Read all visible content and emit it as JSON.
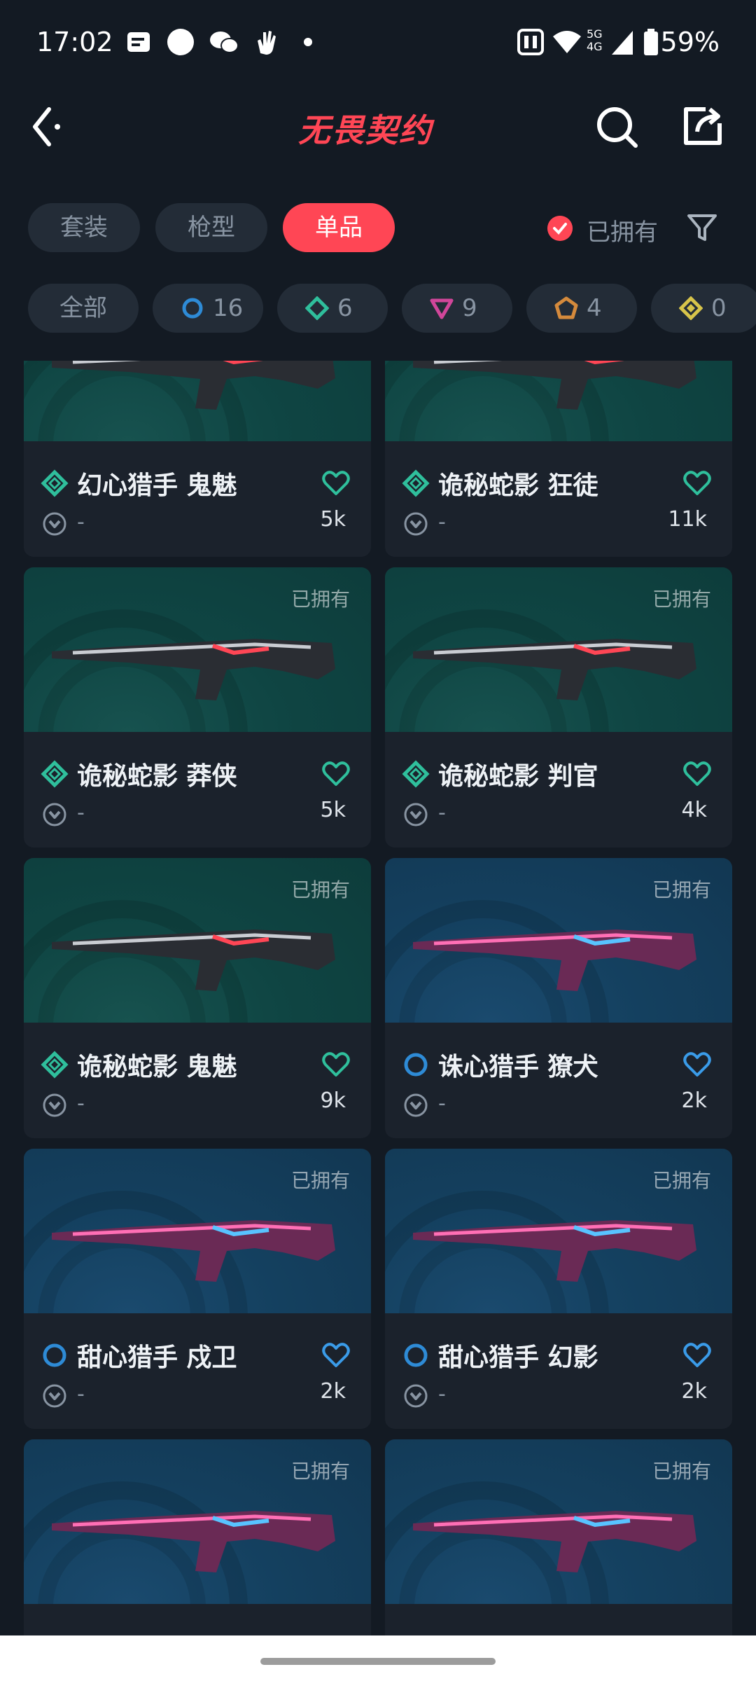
{
  "status_bar": {
    "time": "17:02",
    "network": "5G 4G",
    "battery": "59%"
  },
  "header": {
    "logo": "无畏契约"
  },
  "categories": [
    {
      "label": "套装",
      "active": false
    },
    {
      "label": "枪型",
      "active": false
    },
    {
      "label": "单品",
      "active": true
    }
  ],
  "owned_filter": {
    "label": "已拥有",
    "checked": true
  },
  "tiers": [
    {
      "label": "全部",
      "icon": "all",
      "color": ""
    },
    {
      "label": "16",
      "icon": "circle-tier-icon",
      "color": "#2e8bd6"
    },
    {
      "label": "6",
      "icon": "diamond-tier-icon",
      "color": "#2fbf9c"
    },
    {
      "label": "9",
      "icon": "triangle-tier-icon",
      "color": "#d1469a"
    },
    {
      "label": "4",
      "icon": "pentagon-tier-icon",
      "color": "#d48a3c"
    },
    {
      "label": "0",
      "icon": "rhombus-tier-icon",
      "color": "#d7c44a"
    }
  ],
  "items": [
    {
      "name": "幻心猎手 鬼魅",
      "price": "-",
      "count": "5k",
      "owned_badge": "",
      "theme": "teal"
    },
    {
      "name": "诡秘蛇影 狂徒",
      "price": "-",
      "count": "11k",
      "owned_badge": "",
      "theme": "teal"
    },
    {
      "name": "诡秘蛇影 莽侠",
      "price": "-",
      "count": "5k",
      "owned_badge": "已拥有",
      "theme": "teal"
    },
    {
      "name": "诡秘蛇影 判官",
      "price": "-",
      "count": "4k",
      "owned_badge": "已拥有",
      "theme": "teal"
    },
    {
      "name": "诡秘蛇影 鬼魅",
      "price": "-",
      "count": "9k",
      "owned_badge": "已拥有",
      "theme": "teal"
    },
    {
      "name": "诛心猎手 獠犬",
      "price": "-",
      "count": "2k",
      "owned_badge": "已拥有",
      "theme": "blue"
    },
    {
      "name": "甜心猎手 戍卫",
      "price": "-",
      "count": "2k",
      "owned_badge": "已拥有",
      "theme": "blue"
    },
    {
      "name": "甜心猎手 幻影",
      "price": "-",
      "count": "2k",
      "owned_badge": "已拥有",
      "theme": "blue"
    },
    {
      "name": "",
      "price": "",
      "count": "",
      "owned_badge": "已拥有",
      "theme": "blue"
    },
    {
      "name": "",
      "price": "",
      "count": "",
      "owned_badge": "已拥有",
      "theme": "blue"
    }
  ]
}
